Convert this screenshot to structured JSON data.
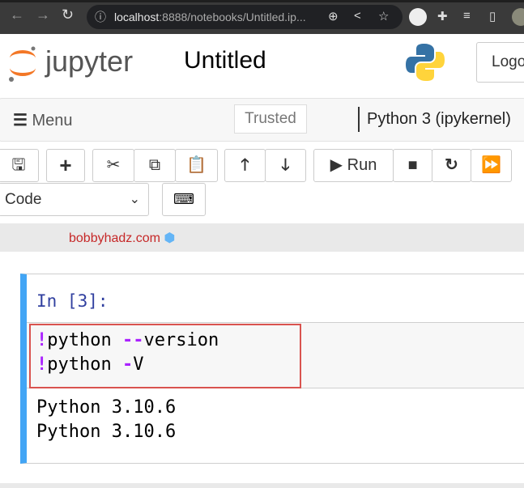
{
  "browser": {
    "url_host": "localhost",
    "url_rest": ":8888/notebooks/Untitled.ip..."
  },
  "header": {
    "logo": "jupyter",
    "title": "Untitled",
    "logout": "Logo"
  },
  "menubar": {
    "menu": "Menu",
    "trusted": "Trusted",
    "kernel": "Python 3 (ipykernel)"
  },
  "toolbar": {
    "run": "Run",
    "cell_type": "Code"
  },
  "watermark": "bobbyhadz.com",
  "cell": {
    "prompt": "In [3]:",
    "lines": [
      {
        "bang": "!",
        "cmd": "python ",
        "op": "--",
        "arg": "version"
      },
      {
        "bang": "!",
        "cmd": "python ",
        "op": "-",
        "arg": "V"
      }
    ],
    "output": [
      "Python 3.10.6",
      "Python 3.10.6"
    ]
  }
}
